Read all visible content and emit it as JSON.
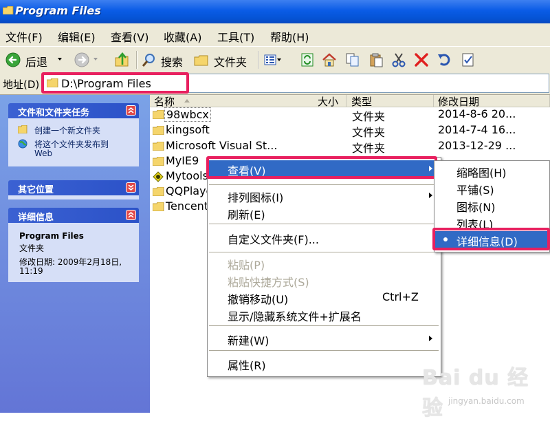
{
  "window": {
    "title": "Program Files"
  },
  "menubar": {
    "items": [
      "文件(F)",
      "编辑(E)",
      "查看(V)",
      "收藏(A)",
      "工具(T)",
      "帮助(H)"
    ]
  },
  "toolbar": {
    "back_label": "后退",
    "search_label": "搜索",
    "folders_label": "文件夹"
  },
  "address": {
    "label": "地址(D)",
    "path": "D:\\Program Files"
  },
  "taskpane": {
    "file_tasks": {
      "title": "文件和文件夹任务",
      "items": [
        "创建一个新文件夹",
        "将这个文件夹发布到",
        "Web"
      ]
    },
    "other_places": {
      "title": "其它位置"
    },
    "details": {
      "title": "详细信息",
      "name": "Program Files",
      "type": "文件夹",
      "modified": "修改日期: 2009年2月18日,",
      "modified_time": "11:19"
    }
  },
  "columns": {
    "name": "名称",
    "size": "大小",
    "type": "类型",
    "modified": "修改日期"
  },
  "files": [
    {
      "name": "98wbcx",
      "type": "文件夹",
      "modified": "2014-8-6 20..."
    },
    {
      "name": "kingsoft",
      "type": "文件夹",
      "modified": "2014-7-4 16..."
    },
    {
      "name": "Microsoft Visual St...",
      "type": "文件夹",
      "modified": "2013-12-29 ..."
    },
    {
      "name": "MyIE9",
      "type": "",
      "modified": ""
    },
    {
      "name": "Mytools",
      "type": "",
      "modified": ""
    },
    {
      "name": "QQPlaye",
      "type": "",
      "modified": ""
    },
    {
      "name": "Tencent",
      "type": "",
      "modified": ""
    }
  ],
  "context_menu": {
    "view": "查看(V)",
    "arrange": "排列图标(I)",
    "refresh": "刷新(E)",
    "customize": "自定义文件夹(F)...",
    "paste": "粘贴(P)",
    "paste_shortcut": "粘贴快捷方式(S)",
    "undo_move": "撤销移动(U)",
    "undo_accel": "Ctrl+Z",
    "show_hide": "显示/隐藏系统文件+扩展名",
    "new": "新建(W)",
    "properties": "属性(R)"
  },
  "view_submenu": {
    "items": [
      "缩略图(H)",
      "平铺(S)",
      "图标(N)",
      "列表(L)",
      "详细信息(D)"
    ],
    "selected": "详细信息(D)"
  },
  "watermark": {
    "logo": "Bai du 经验",
    "url": "jingyan.baidu.com"
  },
  "colors": {
    "highlight": "#e8205f",
    "selection": "#316ac5",
    "title_blue": "#0a5ce6"
  }
}
